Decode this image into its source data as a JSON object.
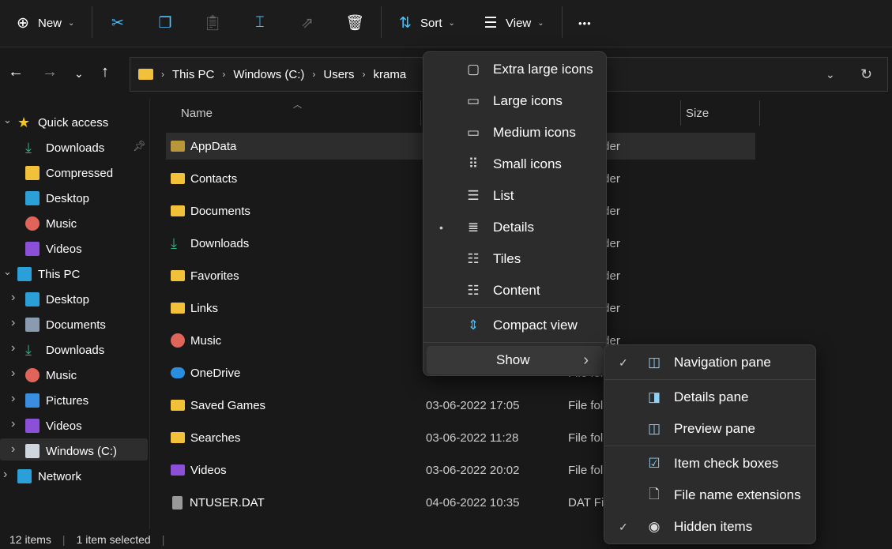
{
  "toolbar": {
    "new_label": "New",
    "sort_label": "Sort",
    "view_label": "View",
    "more_label": "•••"
  },
  "address": {
    "crumbs": [
      "This PC",
      "Windows (C:)",
      "Users",
      "krama"
    ]
  },
  "sidebar": {
    "items": [
      {
        "label": "Quick access",
        "icon": "star-icon",
        "color": "#f5c518",
        "level": 0,
        "expand": "v"
      },
      {
        "label": "Downloads",
        "icon": "download-icon",
        "color": "#2fb38a",
        "level": 1,
        "pinned": true
      },
      {
        "label": "Compressed",
        "icon": "folder-icon",
        "color": "#f2c13a",
        "level": 1
      },
      {
        "label": "Desktop",
        "icon": "desktop-icon",
        "color": "#2a9fd8",
        "level": 1
      },
      {
        "label": "Music",
        "icon": "music-icon",
        "color": "#e0645a",
        "level": 1
      },
      {
        "label": "Videos",
        "icon": "videos-icon",
        "color": "#8b4fd8",
        "level": 1
      },
      {
        "label": "This PC",
        "icon": "computer-icon",
        "color": "#2a9fd8",
        "level": 0,
        "expand": "v"
      },
      {
        "label": "Desktop",
        "icon": "desktop-icon",
        "color": "#2a9fd8",
        "level": 1,
        "expand": ">"
      },
      {
        "label": "Documents",
        "icon": "documents-icon",
        "color": "#8a9bb0",
        "level": 1,
        "expand": ">"
      },
      {
        "label": "Downloads",
        "icon": "download-icon",
        "color": "#2fb38a",
        "level": 1,
        "expand": ">"
      },
      {
        "label": "Music",
        "icon": "music-icon",
        "color": "#e0645a",
        "level": 1,
        "expand": ">"
      },
      {
        "label": "Pictures",
        "icon": "pictures-icon",
        "color": "#3a8ee0",
        "level": 1,
        "expand": ">"
      },
      {
        "label": "Videos",
        "icon": "videos-icon",
        "color": "#8b4fd8",
        "level": 1,
        "expand": ">"
      },
      {
        "label": "Windows (C:)",
        "icon": "drive-icon",
        "color": "#cfd6dd",
        "level": 1,
        "expand": ">",
        "selected": true
      },
      {
        "label": "Network",
        "icon": "network-icon",
        "color": "#2a9fd8",
        "level": 0,
        "expand": ">"
      }
    ]
  },
  "columns": {
    "name": "Name",
    "size": "Size"
  },
  "files": [
    {
      "name": "AppData",
      "icon": "folder-icon",
      "color": "#b8963a",
      "date": "",
      "type": "File folder",
      "selected": true
    },
    {
      "name": "Contacts",
      "icon": "folder-icon",
      "color": "#f2c13a",
      "date": "",
      "type": "File folder"
    },
    {
      "name": "Documents",
      "icon": "folder-icon",
      "color": "#f2c13a",
      "date": "",
      "type": "File folder"
    },
    {
      "name": "Downloads",
      "icon": "download-icon",
      "color": "#2fb38a",
      "date": "",
      "type": "File folder"
    },
    {
      "name": "Favorites",
      "icon": "folder-icon",
      "color": "#f2c13a",
      "date": "",
      "type": "File folder"
    },
    {
      "name": "Links",
      "icon": "folder-icon",
      "color": "#f2c13a",
      "date": "",
      "type": "File folder"
    },
    {
      "name": "Music",
      "icon": "music-icon",
      "color": "#e0645a",
      "date": "",
      "type": "File folder"
    },
    {
      "name": "OneDrive",
      "icon": "cloud-icon",
      "color": "#2a8ee0",
      "date": "",
      "type": "File folder"
    },
    {
      "name": "Saved Games",
      "icon": "folder-icon",
      "color": "#f2c13a",
      "date": "03-06-2022 17:05",
      "type": "File fol"
    },
    {
      "name": "Searches",
      "icon": "folder-icon",
      "color": "#f2c13a",
      "date": "03-06-2022 11:28",
      "type": "File fol"
    },
    {
      "name": "Videos",
      "icon": "videos-icon",
      "color": "#8b4fd8",
      "date": "03-06-2022 20:02",
      "type": "File fol"
    },
    {
      "name": "NTUSER.DAT",
      "icon": "file-icon",
      "color": "#999999",
      "date": "04-06-2022 10:35",
      "type": "DAT Fi"
    }
  ],
  "view_menu": {
    "items": [
      {
        "label": "Extra large icons",
        "icon": "extra-large-icons-icon",
        "glyph": "▢"
      },
      {
        "label": "Large icons",
        "icon": "large-icons-icon",
        "glyph": "▭"
      },
      {
        "label": "Medium icons",
        "icon": "medium-icons-icon",
        "glyph": "▭"
      },
      {
        "label": "Small icons",
        "icon": "small-icons-icon",
        "glyph": "⠿"
      },
      {
        "label": "List",
        "icon": "list-icon",
        "glyph": "☰"
      },
      {
        "label": "Details",
        "icon": "details-icon",
        "glyph": "≣",
        "selected": true
      },
      {
        "label": "Tiles",
        "icon": "tiles-icon",
        "glyph": "☷"
      },
      {
        "label": "Content",
        "icon": "content-icon",
        "glyph": "☷"
      },
      {
        "label": "Compact view",
        "icon": "compact-view-icon",
        "glyph": "⇕"
      }
    ],
    "show_label": "Show"
  },
  "show_menu": {
    "items": [
      {
        "label": "Navigation pane",
        "icon": "navigation-pane-icon",
        "glyph": "◫",
        "checked": true
      },
      {
        "label": "Details pane",
        "icon": "details-pane-icon",
        "glyph": "◨"
      },
      {
        "label": "Preview pane",
        "icon": "preview-pane-icon",
        "glyph": "◫"
      },
      {
        "label": "Item check boxes",
        "icon": "item-check-boxes-icon",
        "glyph": "☑"
      },
      {
        "label": "File name extensions",
        "icon": "file-name-extensions-icon",
        "glyph": "🗋"
      },
      {
        "label": "Hidden items",
        "icon": "hidden-items-icon",
        "glyph": "◉",
        "checked": true
      }
    ]
  },
  "status": {
    "count": "12 items",
    "selection": "1 item selected"
  },
  "colors": {
    "accent": "#4cc2ff",
    "background": "#191919",
    "menu": "#2c2c2c"
  }
}
